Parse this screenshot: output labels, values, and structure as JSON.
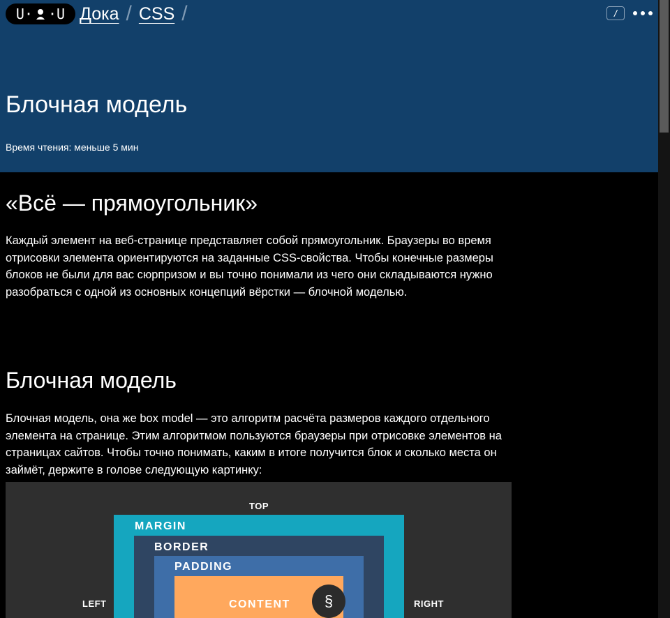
{
  "header": {
    "logo_left": "U·",
    "logo_right": "·U",
    "logo_icon": "person-icon",
    "breadcrumbs": [
      "Дока",
      "CSS"
    ],
    "separator": "/",
    "kbd_hint": "/",
    "more_icon": "ellipsis-icon",
    "color": "#12406a"
  },
  "article": {
    "title": "Блочная модель",
    "reading_time": "Время чтения: меньше 5 мин",
    "section1_title": "«Всё — прямоугольник»",
    "section1_text": "Каждый элемент на веб-странице представляет собой прямоугольник. Браузеры во время отрисовки элемента ориентируются на заданные CSS-свойства. Чтобы конечные размеры блоков не были для вас сюрпризом и вы точно понимали из чего они складываются нужно разобраться с одной из основных концепций вёрстки — блочной моделью.",
    "section2_title": "Блочная модель",
    "section2_text": "Блочная модель, она же box model — это алгоритм расчёта размеров каждого отдельного элемента на странице. Этим алгоритмом пользуются браузеры при отрисовке элементов на страницах сайтов. Чтобы точно понимать, каким в итоге получится блок и сколько места он займёт, держите в голове следующую картинку:"
  },
  "figure": {
    "top": "TOP",
    "left": "LEFT",
    "right": "RIGHT",
    "margin": "MARGIN",
    "border": "BORDER",
    "padding": "PADDING",
    "content": "CONTENT",
    "colors": {
      "margin": "#15a6bf",
      "border": "#2f4562",
      "padding": "#3e6ea8",
      "content": "#ffa85d",
      "background": "#2f2f2f"
    }
  },
  "fab": {
    "symbol": "§"
  }
}
